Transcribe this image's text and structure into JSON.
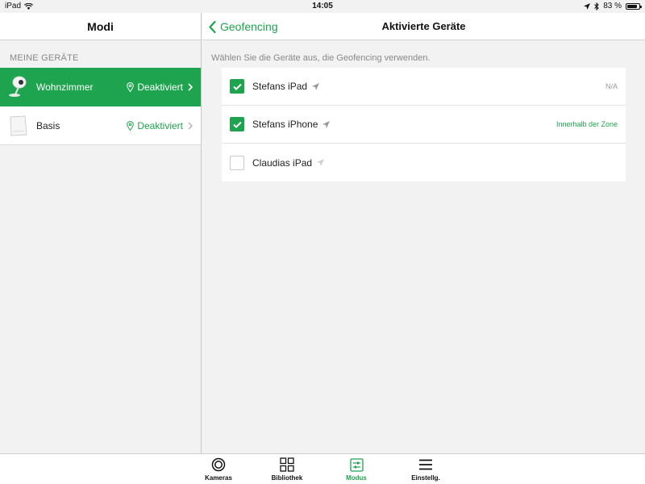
{
  "statusbar": {
    "device": "iPad",
    "time": "14:05",
    "battery": "83 %",
    "battery_level": 0.83
  },
  "left": {
    "title": "Modi",
    "section_label": "MEINE GERÄTE",
    "devices": [
      {
        "name": "Wohnzimmer",
        "status": "Deaktiviert",
        "active": true,
        "icon": "camera-icon"
      },
      {
        "name": "Basis",
        "status": "Deaktiviert",
        "active": false,
        "icon": "base-station-icon"
      }
    ]
  },
  "right": {
    "back_label": "Geofencing",
    "title": "Aktivierte Geräte",
    "hint": "Wählen Sie die Geräte aus, die Geofencing verwenden.",
    "items": [
      {
        "name": "Stefans iPad",
        "checked": true,
        "status": "N/A",
        "status_color": "#999999"
      },
      {
        "name": "Stefans iPhone",
        "checked": true,
        "status": "Innerhalb der Zone",
        "status_color": "#1ea34f"
      },
      {
        "name": "Claudias iPad",
        "checked": false,
        "status": "",
        "status_color": "#999999"
      }
    ]
  },
  "tabs": [
    {
      "label": "Kameras",
      "icon": "camera-lens-icon",
      "active": false
    },
    {
      "label": "Bibliothek",
      "icon": "grid-icon",
      "active": false
    },
    {
      "label": "Modus",
      "icon": "mode-sliders-icon",
      "active": true
    },
    {
      "label": "Einstellg.",
      "icon": "menu-icon",
      "active": false
    }
  ],
  "colors": {
    "accent": "#1ea34f",
    "background": "#f2f2f2"
  }
}
